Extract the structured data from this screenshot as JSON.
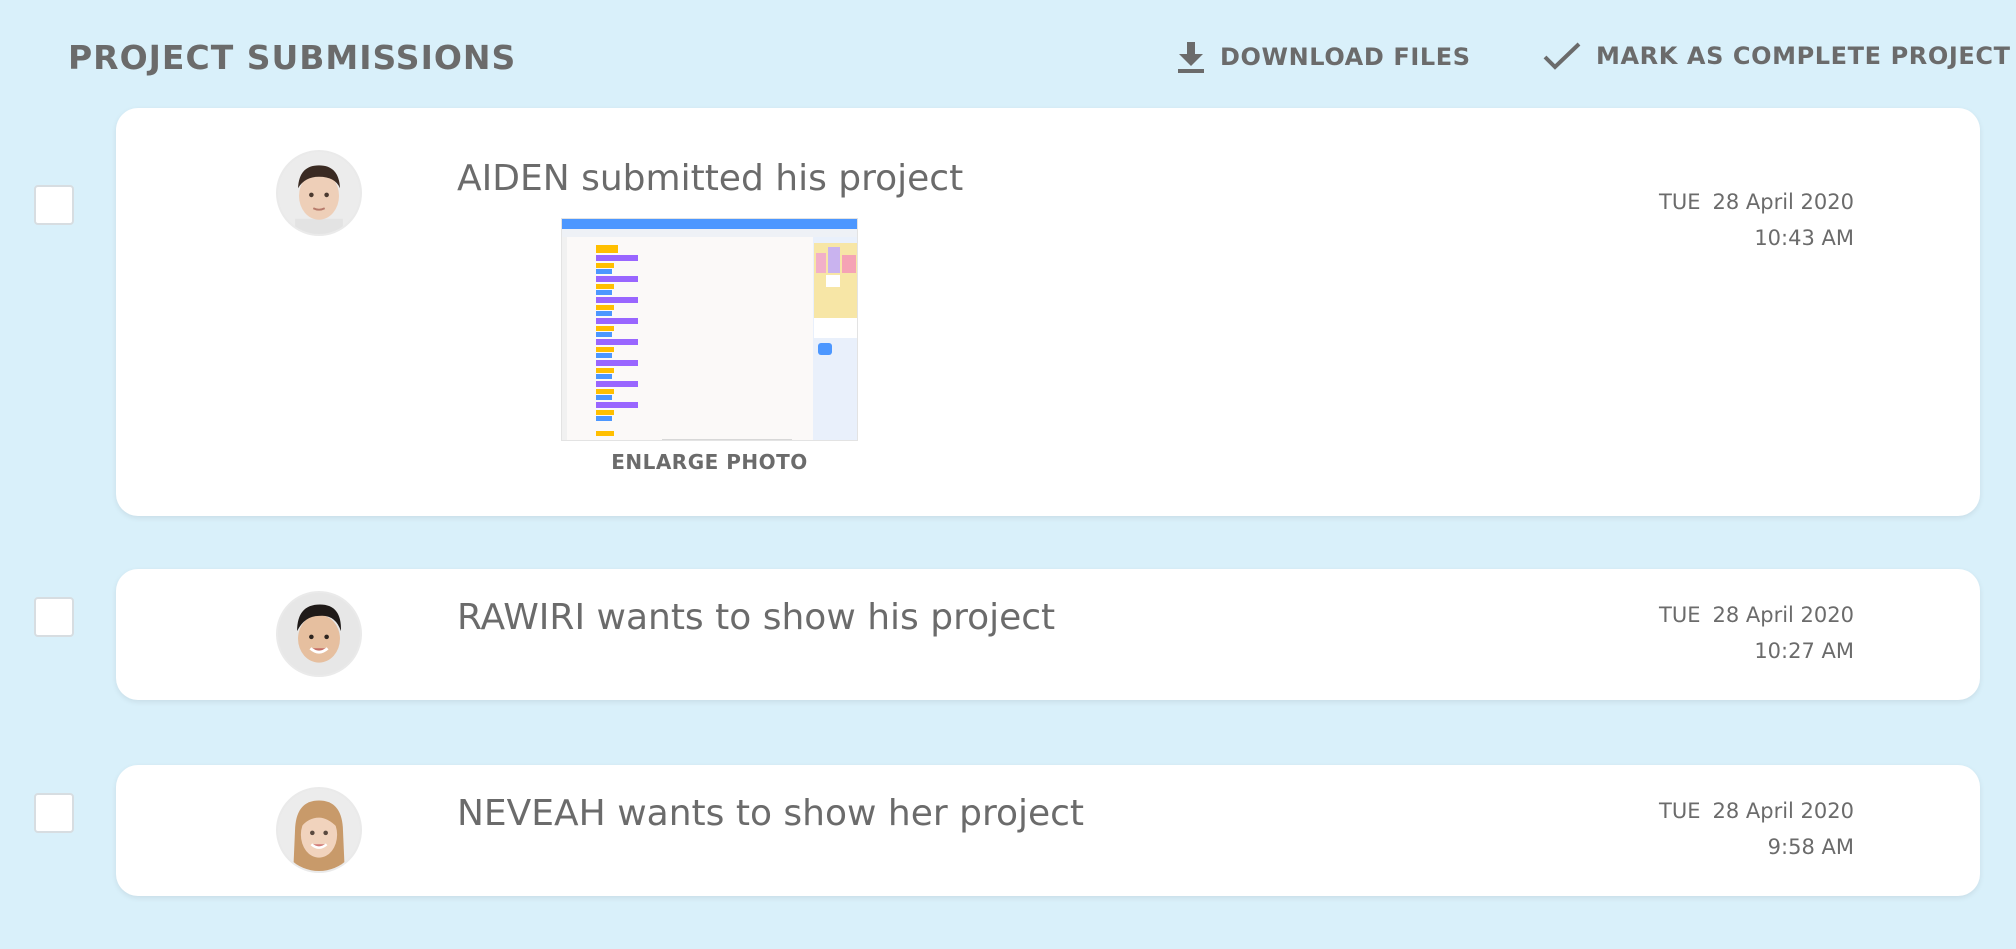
{
  "header": {
    "title": "PROJECT SUBMISSIONS",
    "download_label": "DOWNLOAD FILES",
    "complete_label": "MARK AS COMPLETE PROJECT"
  },
  "submissions": [
    {
      "message": "AIDEN submitted his project",
      "day": "TUE",
      "date": "28 April 2020",
      "time": "10:43 AM",
      "checked": false,
      "enlarge_label": "ENLARGE PHOTO"
    },
    {
      "message": "RAWIRI wants to show his project",
      "day": "TUE",
      "date": "28 April 2020",
      "time": "10:27 AM",
      "checked": false
    },
    {
      "message": "NEVEAH wants to show her project",
      "day": "TUE",
      "date": "28 April 2020",
      "time": "9:58 AM",
      "checked": false
    }
  ],
  "colors": {
    "background": "#d9f0fa",
    "card": "#ffffff",
    "text": "#6b6b6b",
    "thumb_header": "#4c97ff"
  },
  "icons": {
    "download": "download-icon",
    "complete": "checkmark-icon"
  }
}
